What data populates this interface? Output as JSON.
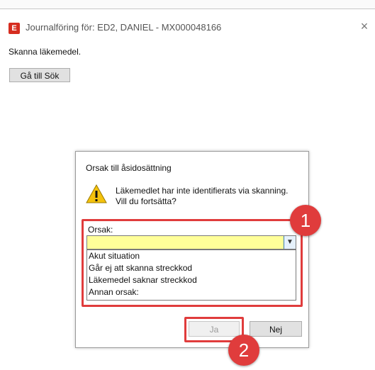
{
  "window": {
    "app_icon_letter": "E",
    "title": "Journalföring för: ED2, DANIEL - MX000048166",
    "close_symbol": "×"
  },
  "main": {
    "instruction": "Skanna läkemedel.",
    "goto_search_button": "Gå till Sök"
  },
  "dialog": {
    "title": "Orsak till åsidosättning",
    "message_line1": "Läkemedlet har inte identifierats via skanning.",
    "message_line2": "Vill du fortsätta?",
    "reason_label": "Orsak:",
    "reason_value": "",
    "reason_options": [
      "Akut situation",
      "Går ej att skanna streckkod",
      "Läkemedel saknar streckkod",
      "Annan orsak:"
    ],
    "yes_button": "Ja",
    "no_button": "Nej"
  },
  "annotations": {
    "badge_1": "1",
    "badge_2": "2",
    "highlight_color": "#e03c3c"
  },
  "icons": {
    "warning": "warning-icon",
    "dropdown": "chevron-down-icon",
    "close": "close-icon"
  }
}
